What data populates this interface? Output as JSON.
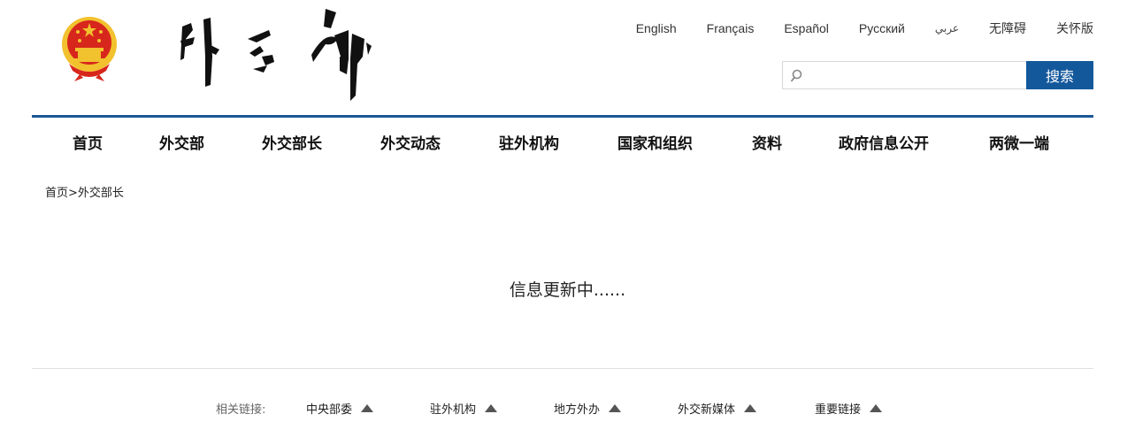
{
  "header": {
    "emblem_icon": "national-emblem-icon",
    "logo_icon": "calligraphy-logo-icon",
    "languages": [
      "English",
      "Français",
      "Español",
      "Русский",
      "عربي",
      "无障碍",
      "关怀版"
    ],
    "search": {
      "placeholder": "",
      "button_label": "搜索"
    }
  },
  "nav": {
    "items": [
      "首页",
      "外交部",
      "外交部长",
      "外交动态",
      "驻外机构",
      "国家和组织",
      "资料",
      "政府信息公开",
      "两微一端"
    ]
  },
  "breadcrumb": {
    "home": "首页",
    "separator": ">",
    "current": "外交部长"
  },
  "main": {
    "status_text": "信息更新中......"
  },
  "footer": {
    "links_label": "相关链接:",
    "links": [
      "中央部委",
      "驻外机构",
      "地方外办",
      "外交新媒体",
      "重要链接"
    ]
  },
  "colors": {
    "accent": "#14589c",
    "nav_rule": "#1b5896",
    "emblem_red": "#d7261c",
    "emblem_gold": "#f2c12e"
  }
}
